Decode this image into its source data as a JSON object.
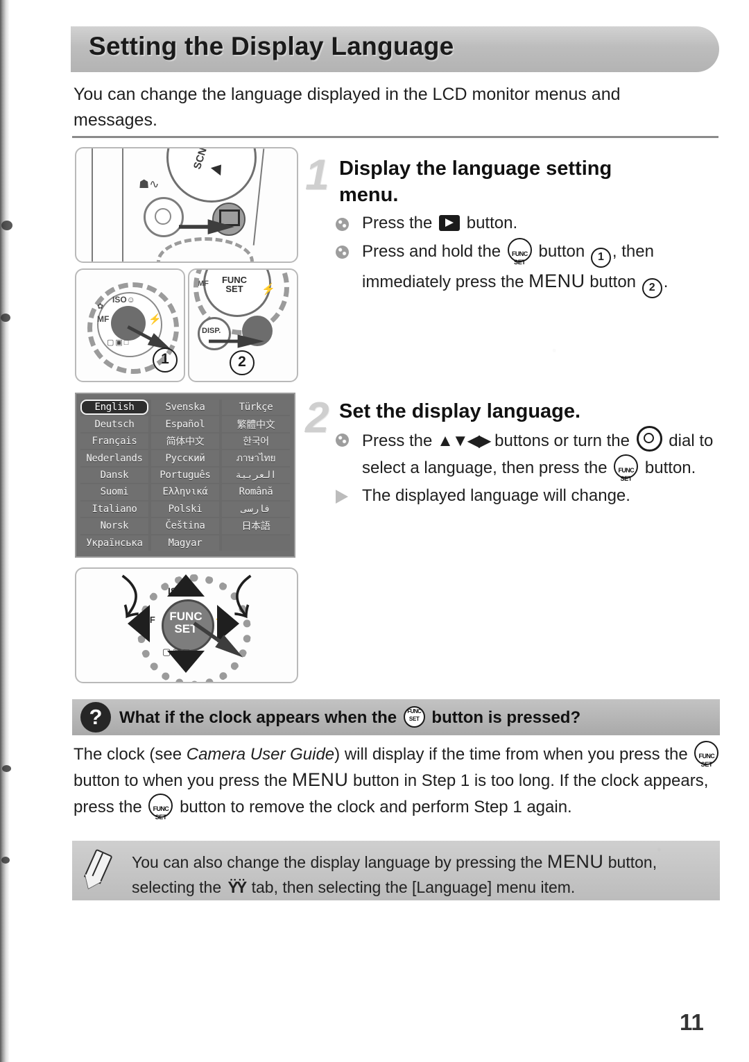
{
  "header": {
    "title": "Setting the Display Language"
  },
  "intro": "You can change the language displayed in the LCD monitor menus and messages.",
  "steps": [
    {
      "number": "1",
      "title": "Display the language setting menu.",
      "line1_a": "Press the",
      "line1_icon": "playback-icon",
      "line1_b": "button.",
      "line2_a": "Press and hold the",
      "line2_icon": "func-set-icon",
      "line2_b": "button",
      "line2_marker": "1",
      "line2_c": ", then immediately press the",
      "line2_menu": "MENU",
      "line2_d": "button",
      "line2_marker2": "2",
      "line2_e": "."
    },
    {
      "number": "2",
      "title": "Set the display language.",
      "line1_a": "Press the",
      "line1_arrows": "▲▼◀▶",
      "line1_b": "buttons or turn the",
      "line1_icon": "control-dial-icon",
      "line1_c": "dial to select a language, then press the",
      "line1_icon2": "func-set-icon",
      "line1_d": "button.",
      "result": "The displayed language will change."
    }
  ],
  "lcd": {
    "selected": "English",
    "languages": [
      "English",
      "Svenska",
      "Türkçe",
      "Deutsch",
      "Español",
      "繁體中文",
      "Français",
      "简体中文",
      "한국어",
      "Nederlands",
      "Русский",
      "ภาษาไทย",
      "Dansk",
      "Português",
      "العربية",
      "Suomi",
      "Ελληνικά",
      "Română",
      "Italiano",
      "Polski",
      "فارسى",
      "Norsk",
      "Čeština",
      "日本語",
      "Українська",
      "Magyar",
      ""
    ]
  },
  "figures": {
    "top_caption": "camera-top-playback-button",
    "detail1_marker": "1",
    "detail2_marker": "2",
    "dial_labels": {
      "func": "FUNC",
      "set": "SET",
      "iso": "ISO",
      "mf": "MF",
      "disp": "DISP."
    },
    "mode_dial_label": "SCN"
  },
  "question": {
    "icon": "?",
    "title_a": "What if the clock appears when the",
    "title_icon": "func-set-icon",
    "title_b": "button is pressed?",
    "body_1": "The clock (see",
    "body_italic": "Camera User Guide",
    "body_2": ") will display if the time from when you press the",
    "body_3": "button to when you press the",
    "body_menu": "MENU",
    "body_4": "button in Step 1 is too long. If the clock appears, press the",
    "body_5": "button to remove the clock and perform Step 1 again."
  },
  "note": {
    "icon": "pencil-icon",
    "text_1": "You can also change the display language by pressing the",
    "text_menu": "MENU",
    "text_2": "button, selecting the",
    "tab_icon": "ŸŸ",
    "text_3": "tab, then selecting the [Language] menu item."
  },
  "page_number": "11",
  "colors": {
    "header_bar": "#bdbdbd",
    "banner": "#b3b3b3",
    "note_bg": "#c6c6c6",
    "lcd_bg": "#6a6a6a",
    "rule": "#8a8a8a"
  }
}
